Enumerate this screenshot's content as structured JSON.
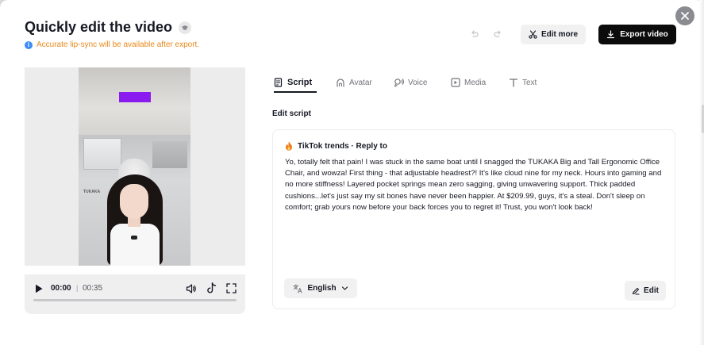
{
  "header": {
    "title": "Quickly edit the video",
    "notice": "Accurate lip-sync will be available after export.",
    "edit_more_label": "Edit more",
    "export_label": "Export video"
  },
  "player": {
    "current_time": "00:00",
    "separator": "|",
    "duration": "00:35",
    "progress_fraction": 0
  },
  "preview": {
    "overlay_logo_text": "TUKAKA"
  },
  "tabs": [
    {
      "label": "Script",
      "icon": "script-icon",
      "active": true
    },
    {
      "label": "Avatar",
      "icon": "avatar-icon",
      "active": false
    },
    {
      "label": "Voice",
      "icon": "voice-icon",
      "active": false
    },
    {
      "label": "Media",
      "icon": "media-icon",
      "active": false
    },
    {
      "label": "Text",
      "icon": "text-icon",
      "active": false
    }
  ],
  "script": {
    "section_label": "Edit script",
    "title": "TikTok trends · Reply to",
    "body": "Yo, totally felt that pain! I was stuck in the same boat until I snagged the TUKAKA Big and Tall Ergonomic Office Chair, and wowza! First thing - that adjustable headrest?! It's like cloud nine for my neck. Hours into gaming and no more stiffness! Layered pocket springs mean zero sagging, giving unwavering support. Thick padded cushions...let's just say my sit bones have never been happier. At $209.99, guys, it's a steal. Don't sleep on comfort; grab yours now before your back forces you to regret it! Trust, you won't look back!",
    "language": "English",
    "edit_label": "Edit"
  },
  "colors": {
    "notice": "#e8891a",
    "info": "#3c8bf5",
    "accent_bar": "#8a1cf0",
    "export_bg": "#0b0b0b"
  }
}
